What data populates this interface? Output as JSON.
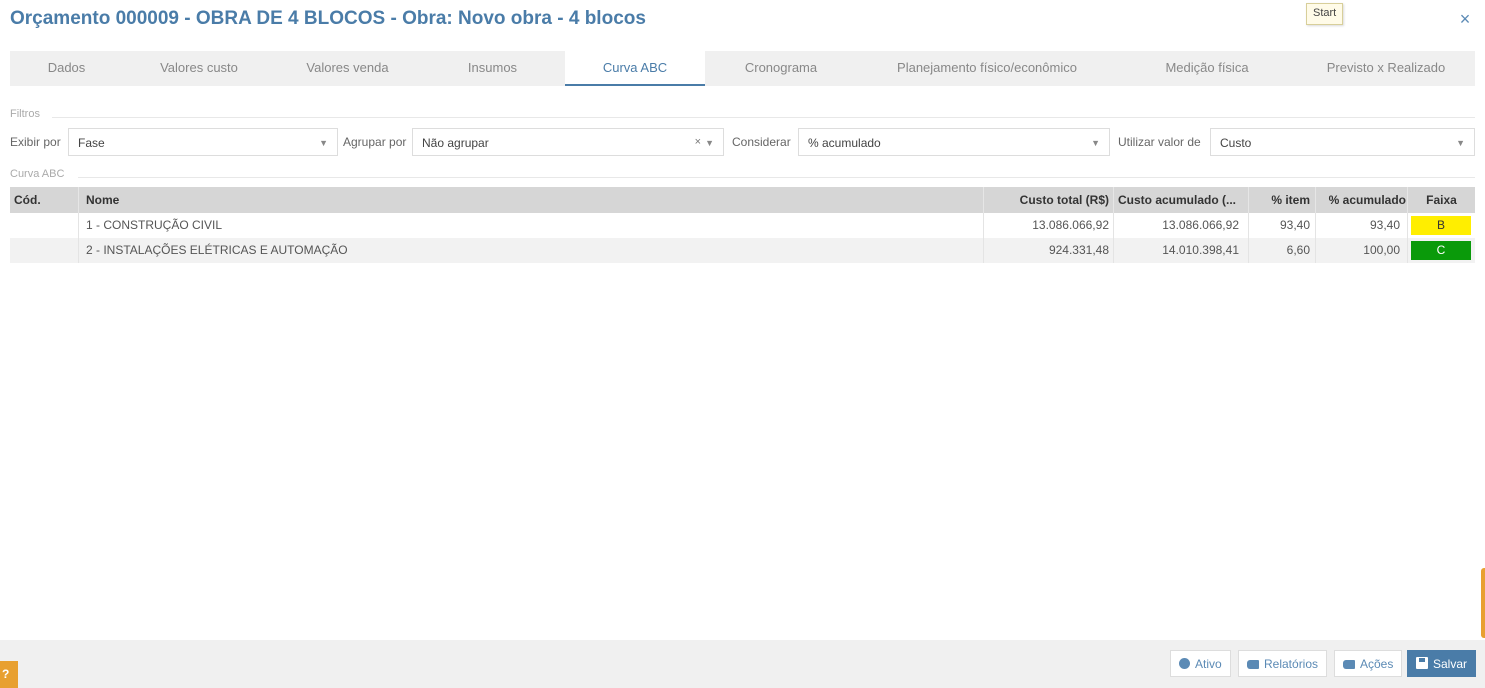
{
  "header": {
    "title": "Orçamento 000009 - OBRA DE 4 BLOCOS - Obra: Novo obra - 4 blocos",
    "tooltip": "Start",
    "close": "×"
  },
  "tabs": [
    {
      "label": "Dados"
    },
    {
      "label": "Valores custo"
    },
    {
      "label": "Valores venda"
    },
    {
      "label": "Insumos"
    },
    {
      "label": "Curva ABC"
    },
    {
      "label": "Cronograma"
    },
    {
      "label": "Planejamento físico/econômico"
    },
    {
      "label": "Medição física"
    },
    {
      "label": "Previsto x Realizado"
    }
  ],
  "active_tab": "Curva ABC",
  "filters": {
    "section_label": "Filtros",
    "exibir_por": {
      "label": "Exibir por",
      "value": "Fase"
    },
    "agrupar_por": {
      "label": "Agrupar por",
      "value": "Não agrupar",
      "clear": "×"
    },
    "considerar": {
      "label": "Considerar",
      "value": "% acumulado"
    },
    "utilizar_valor_de": {
      "label": "Utilizar valor de",
      "value": "Custo"
    }
  },
  "grid": {
    "section_label": "Curva ABC",
    "columns": [
      "Cód.",
      "Nome",
      "Custo total (R$)",
      "Custo acumulado (...",
      "% item",
      "% acumulado",
      "Faixa"
    ],
    "rows": [
      {
        "cod": "",
        "nome": "1 - CONSTRUÇÃO CIVIL",
        "custo_total": "13.086.066,92",
        "custo_acumulado": "13.086.066,92",
        "pct_item": "93,40",
        "pct_acumulado": "93,40",
        "faixa": "B",
        "faixa_color": "#ffee00",
        "faixa_text_color": "#333333"
      },
      {
        "cod": "",
        "nome": "2 - INSTALAÇÕES ELÉTRICAS E AUTOMAÇÃO",
        "custo_total": "924.331,48",
        "custo_acumulado": "14.010.398,41",
        "pct_item": "6,60",
        "pct_acumulado": "100,00",
        "faixa": "C",
        "faixa_color": "#0a9a0a",
        "faixa_text_color": "#ffffff"
      }
    ]
  },
  "footer": {
    "ativo": "Ativo",
    "relatorios": "Relatórios",
    "acoes": "Ações",
    "salvar": "Salvar"
  },
  "colors": {
    "accent": "#4a7ca8",
    "orange": "#e8a030"
  }
}
